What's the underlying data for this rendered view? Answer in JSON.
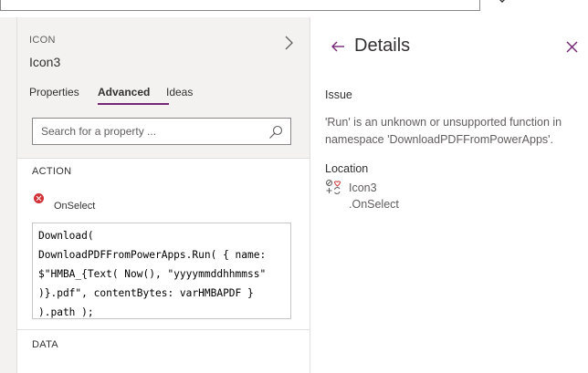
{
  "properties_panel": {
    "control_type": "ICON",
    "control_name": "Icon3",
    "tabs": [
      {
        "label": "Properties"
      },
      {
        "label": "Advanced"
      },
      {
        "label": "Ideas"
      }
    ],
    "active_tab": "Advanced",
    "search": {
      "placeholder": "Search for a property ...",
      "value": ""
    },
    "sections": {
      "action": "ACTION",
      "data": "DATA"
    },
    "property": {
      "name": "OnSelect",
      "formula_lines": [
        "Download(",
        "DownloadPDFFromPowerApps.Run( { name:",
        "$\"HMBA_{Text( Now(), \"yyyymmddhhmmss\"",
        ")}.pdf\", contentBytes: varHMBAPDF }",
        ").path );"
      ]
    }
  },
  "details_panel": {
    "title": "Details",
    "issue_label": "Issue",
    "issue_text": "'Run' is an unknown or unsupported function in namespace 'DownloadPDFFromPowerApps'.",
    "location_label": "Location",
    "location_control": "Icon3",
    "location_property": ".OnSelect"
  },
  "icons": {
    "expand": "chevron-right-icon",
    "search": "search-icon",
    "error": "error-icon",
    "back": "back-arrow-icon",
    "close": "close-icon",
    "control": "icon-control-icon"
  },
  "colors": {
    "accent": "#742774",
    "error": "#d13438",
    "pane_bg": "#f3f2f1"
  }
}
